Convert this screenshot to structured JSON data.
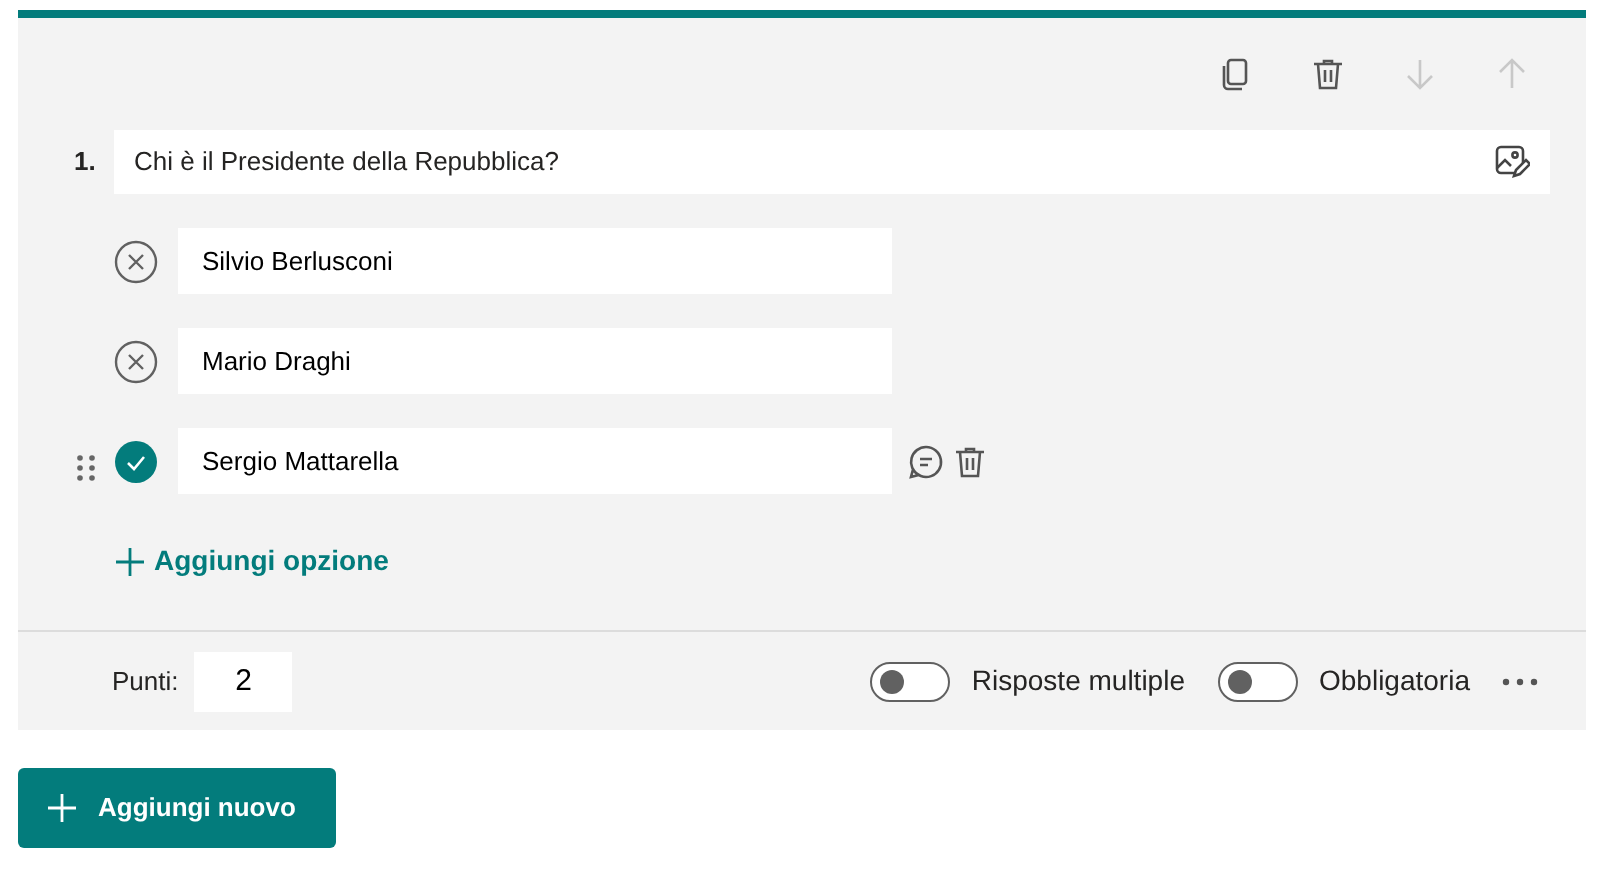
{
  "toolbar": [
    {
      "kind": "copy",
      "disabled": false
    },
    {
      "kind": "delete",
      "disabled": false
    },
    {
      "kind": "down",
      "disabled": true
    },
    {
      "kind": "up",
      "disabled": true
    }
  ],
  "question": {
    "number": "1.",
    "text": "Chi è il Presidente della Repubblica?"
  },
  "options": [
    {
      "text": "Silvio Berlusconi",
      "correct": false
    },
    {
      "text": "Mario Draghi",
      "correct": false
    },
    {
      "text": "Sergio Mattarella",
      "correct": true
    }
  ],
  "add_option": "Aggiungi opzione",
  "points": {
    "label": "Punti:",
    "value": "2"
  },
  "toggles": [
    {
      "label": "Risposte multiple",
      "on": false
    },
    {
      "label": "Obbligatoria",
      "on": false
    }
  ],
  "add_new": "Aggiungi nuovo"
}
